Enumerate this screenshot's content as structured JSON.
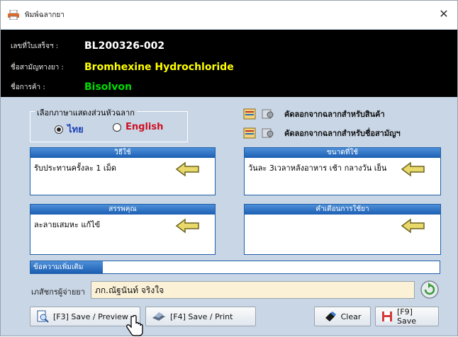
{
  "window": {
    "title": "พิมพ์ฉลากยา",
    "close_label": "✕"
  },
  "header": {
    "receipt_label": "เลขที่ใบเสร็จฯ :",
    "receipt_value": "BL200326-002",
    "generic_label": "ชื่อสามัญทางยา :",
    "generic_value": "Bromhexine Hydrochloride",
    "trade_label": "ชื่อการค้า :",
    "trade_value": "Bisolvon",
    "colors": {
      "receipt": "#ffffff",
      "generic": "#ffff00",
      "trade": "#00dd00"
    }
  },
  "language": {
    "legend": "เลือกภาษาแสดงส่วนหัวฉลาก",
    "thai_label": "ไทย",
    "english_label": "English",
    "selected": "thai"
  },
  "copy_actions": {
    "product_label": "คัดลอกจากฉลากสำหรับสินค้า",
    "generic_label": "คัดลอกจากฉลากสำหรับชื่อสามัญฯ"
  },
  "sections": {
    "usage": {
      "header": "วิธีใช้",
      "text": "รับประทานครั้งละ 1 เม็ด"
    },
    "dosage": {
      "header": "ขนาดที่ใช้",
      "text": "วันละ 3เวลาหลังอาหาร เช้า กลางวัน เย็น"
    },
    "properties": {
      "header": "สรรพคุณ",
      "text": "ละลายเสมหะ แก้ไข้"
    },
    "warnings": {
      "header": "คำเตือนการใช้ยา",
      "text": ""
    }
  },
  "note": {
    "label": "ข้อความเพิ่มเติม",
    "value": ""
  },
  "pharmacist": {
    "label": "เภสัชกรผู้จ่ายยา",
    "value": "ภก.ณัฐนันท์ จริงใจ"
  },
  "buttons": {
    "save_preview": "[F3] Save / Preview",
    "save_print": "[F4] Save / Print",
    "clear": "Clear",
    "save": "[F9] Save"
  }
}
